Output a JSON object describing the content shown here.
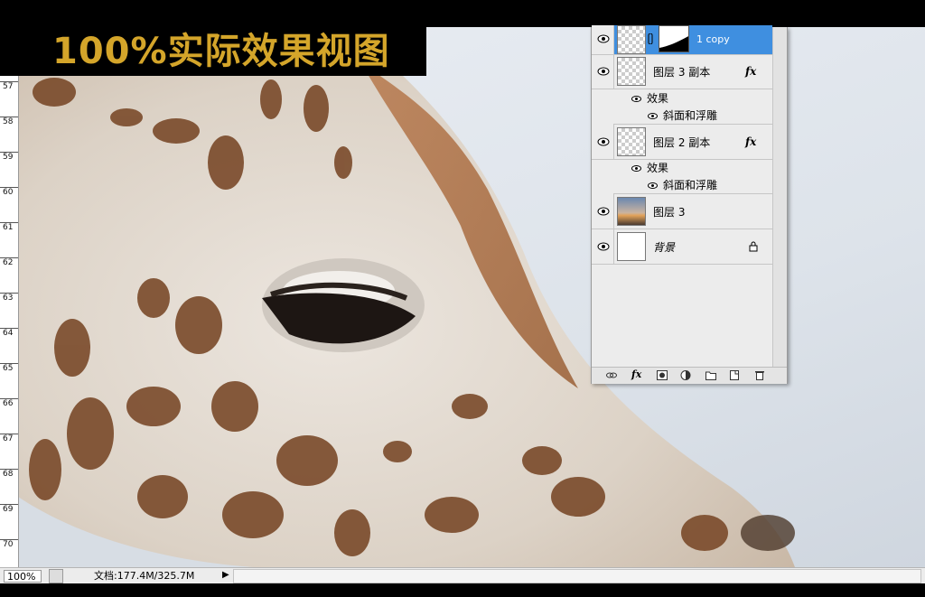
{
  "banner": {
    "title": "100%实际效果视图"
  },
  "ruler": {
    "labels": [
      "57",
      "58",
      "59",
      "60",
      "61",
      "62",
      "63",
      "64",
      "65",
      "66",
      "67",
      "68",
      "69",
      "70"
    ]
  },
  "layers": {
    "items": [
      {
        "name": "1 copy",
        "selected": true,
        "thumb": "checker",
        "has_mask": true
      },
      {
        "name": "图层 3 副本",
        "fx": "fx",
        "effects_label": "效果",
        "effect": "斜面和浮雕",
        "thumb": "checker"
      },
      {
        "name": "图层 2 副本",
        "fx": "fx",
        "effects_label": "效果",
        "effect": "斜面和浮雕",
        "thumb": "checker"
      },
      {
        "name": "图层 3",
        "thumb": "sunset"
      },
      {
        "name": "背景",
        "locked": true,
        "thumb": "white"
      }
    ],
    "footer_icons": [
      "link-icon",
      "fx-icon",
      "mask-icon",
      "adjustment-icon",
      "folder-icon",
      "new-layer-icon",
      "trash-icon"
    ]
  },
  "status": {
    "zoom": "100%",
    "doc": "文档:177.4M/325.7M"
  },
  "colors": {
    "banner_text": "#d4a52a",
    "selected_row": "#3f8fe0",
    "panel_bg": "#ececec"
  }
}
